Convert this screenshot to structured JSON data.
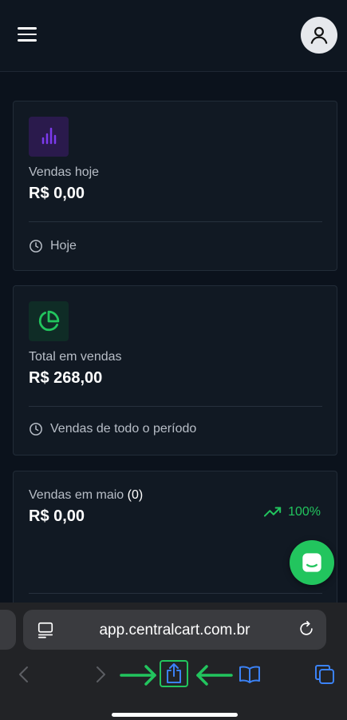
{
  "header": {
    "menu_icon": "hamburger-icon",
    "avatar_icon": "user-icon"
  },
  "cards": [
    {
      "icon": "bar-chart-icon",
      "label": "Vendas hoje",
      "value": "R$ 0,00",
      "footer": "Hoje",
      "footer_icon": "clock-icon"
    },
    {
      "icon": "pie-chart-icon",
      "label": "Total em vendas",
      "value": "R$ 268,00",
      "footer": "Vendas de todo o período",
      "footer_icon": "clock-icon"
    },
    {
      "label": "Vendas em maio",
      "count": "(0)",
      "value": "R$ 0,00",
      "trend": "100%",
      "trend_icon": "trending-up-icon"
    }
  ],
  "chat": {
    "icon": "chat-icon"
  },
  "browser": {
    "url": "app.centralcart.com.br",
    "page_icon": "reader-icon",
    "reload_icon": "reload-icon",
    "toolbar_icons": [
      "back-icon",
      "forward-icon",
      "share-icon",
      "bookmarks-icon",
      "tabs-icon"
    ]
  },
  "colors": {
    "background": "#0b121c",
    "card": "#111923",
    "accent_green": "#22c55e",
    "accent_purple": "#7c3aed"
  }
}
